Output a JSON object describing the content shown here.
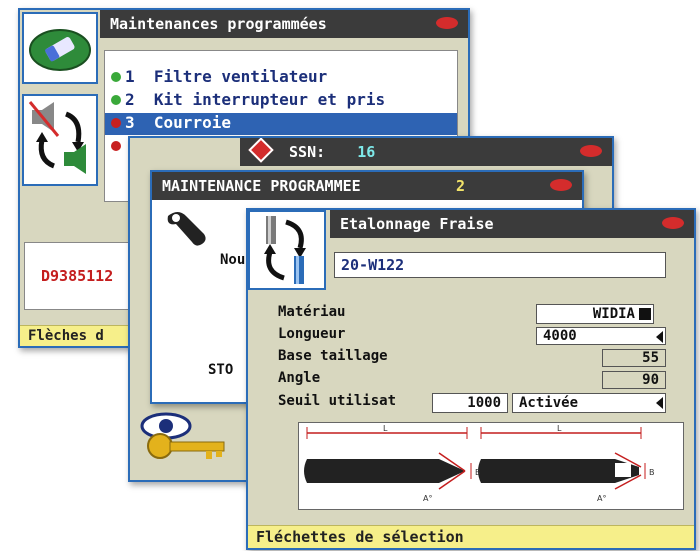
{
  "window1": {
    "title": "Maintenances programmées",
    "items": [
      {
        "num": "1",
        "label": "Filtre ventilateur",
        "dot": "#3aa93a"
      },
      {
        "num": "2",
        "label": "Kit interrupteur et pris",
        "dot": "#3aa93a"
      },
      {
        "num": "3",
        "label": "Courroie",
        "dot": "#c82020"
      }
    ],
    "code": "D9385112",
    "status": "Flèches d"
  },
  "window2": {
    "ssn_label": "SSN:",
    "ssn_value": "16"
  },
  "window3": {
    "title": "MAINTENANCE PROGRAMMEE",
    "count": "2",
    "partial_text_1": "Nou",
    "partial_text_2": "STO"
  },
  "window4": {
    "title": "Etalonnage Fraise",
    "tool_code": "20-W122",
    "rows": {
      "materiau": {
        "label": "Matériau",
        "value": "WIDIA"
      },
      "longueur": {
        "label": "Longueur",
        "value": "4000"
      },
      "base": {
        "label": "Base taillage",
        "value": "55"
      },
      "angle": {
        "label": "Angle",
        "value": "90"
      },
      "seuil": {
        "label": "Seuil utilisat",
        "value": "1000",
        "mode": "Activée"
      }
    },
    "diagram": {
      "dim_l": "L",
      "dim_b": "B",
      "dim_a": "A°"
    },
    "status": "Fléchettes de sélection"
  },
  "colors": {
    "accent": "#2b6cb8",
    "titlebar": "#3b3b3b",
    "panel": "#d8d7bf",
    "status": "#f6ef8a",
    "selected": "#2e63b3"
  }
}
